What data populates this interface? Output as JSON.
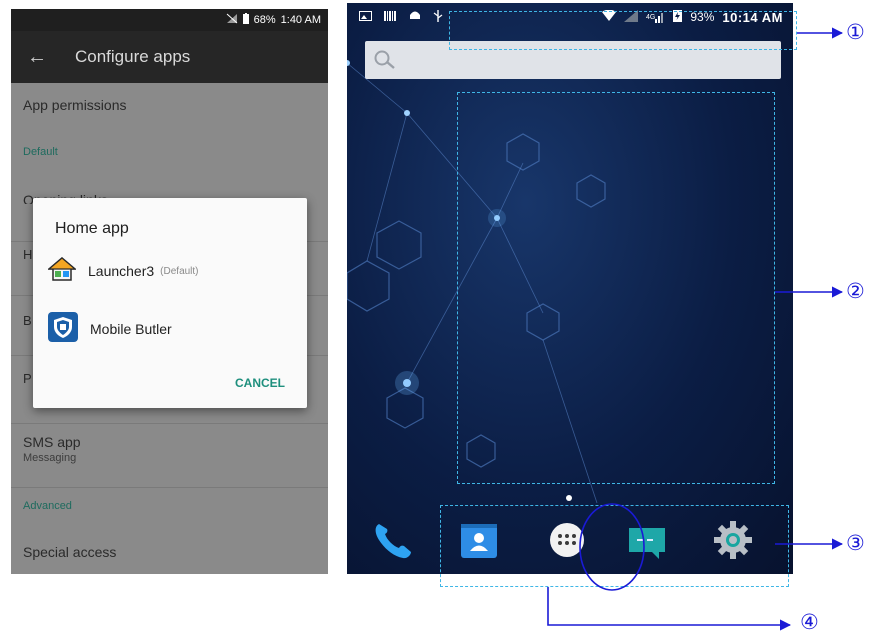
{
  "left_phone": {
    "status": {
      "battery": "68%",
      "time": "1:40 AM"
    },
    "appbar": {
      "title": "Configure apps"
    },
    "list": {
      "app_permissions": "App permissions",
      "default_section": "Default",
      "opening_links": "Opening links",
      "sms_app": "SMS app",
      "sms_sub": "Messaging",
      "advanced_section": "Advanced",
      "special_access": "Special access"
    },
    "dialog": {
      "title": "Home app",
      "options": [
        {
          "name": "Launcher3",
          "tag": "(Default)"
        },
        {
          "name": "Mobile Butler"
        }
      ],
      "cancel": "CANCEL"
    }
  },
  "right_phone": {
    "status": {
      "signal_label": "4G",
      "battery": "93%",
      "time": "10:14 AM"
    }
  },
  "callouts": {
    "c1": "①",
    "c2": "②",
    "c3": "③",
    "c4": "④"
  },
  "colors": {
    "accent": "#1e8f7d",
    "annotation_dash": "#3fb6e6",
    "annotation_arrow": "#1a1ad6"
  }
}
